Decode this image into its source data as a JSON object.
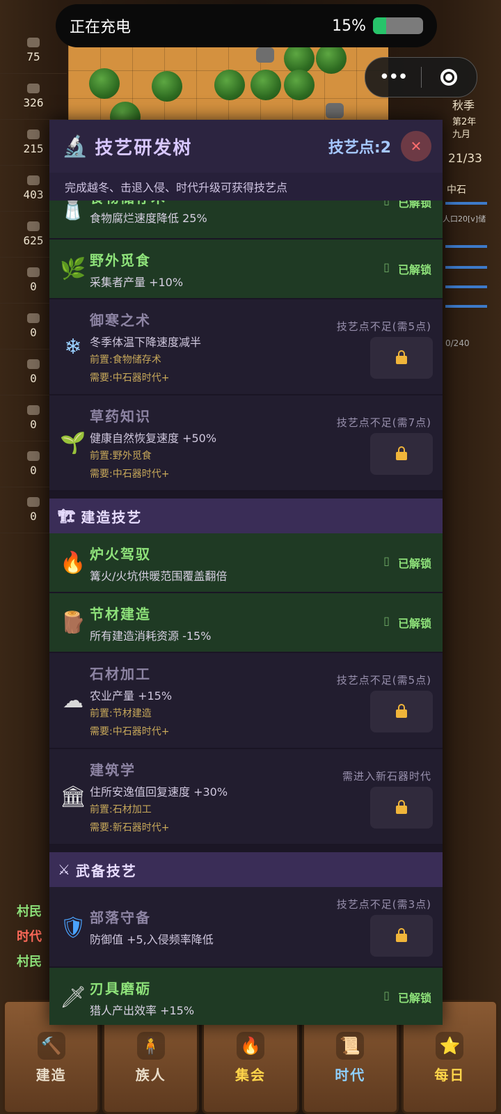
{
  "status_bar": {
    "left_text": "正在充电",
    "battery_percent": "15%",
    "battery_level": 0.15
  },
  "resources": [
    "75",
    "326",
    "215",
    "403",
    "625",
    "0",
    "0",
    "0",
    "0",
    "0",
    "0"
  ],
  "right_panel": {
    "season": "秋季",
    "year": "第2年",
    "month": "九月",
    "count": "21/33",
    "era": "中石",
    "pop": "人口20[v]储",
    "storage": "0/240"
  },
  "left_labels": [
    "村民",
    "时代",
    "村民"
  ],
  "modal": {
    "title": "技艺研发树",
    "tech_points": "技艺点:2",
    "hint": "完成越冬、击退入侵、时代升级可获得技艺点"
  },
  "techs_food": [
    {
      "name": "食物储存术",
      "desc": "食物腐烂速度降低 25%",
      "status": "已解锁",
      "icon": "salt-icon"
    },
    {
      "name": "野外觅食",
      "desc": "采集者产量 +10%",
      "status": "已解锁",
      "icon": "herb-icon"
    },
    {
      "name": "御寒之术",
      "desc": "冬季体温下降速度减半",
      "prereq": "前置:食物储存术",
      "req": "需要:中石器时代+",
      "cost": "技艺点不足(需5点)",
      "icon": "snowflake-icon"
    },
    {
      "name": "草药知识",
      "desc": "健康自然恢复速度 +50%",
      "prereq": "前置:野外觅食",
      "req": "需要:中石器时代+",
      "cost": "技艺点不足(需7点)",
      "icon": "seedling-icon"
    }
  ],
  "section_build": {
    "title": "建造技艺",
    "icon": "crane-icon"
  },
  "techs_build": [
    {
      "name": "炉火驾驭",
      "desc": "篝火/火坑供暖范围覆盖翻倍",
      "status": "已解锁",
      "icon": "fire-icon"
    },
    {
      "name": "节材建造",
      "desc": "所有建造消耗资源 -15%",
      "status": "已解锁",
      "icon": "wood-icon"
    },
    {
      "name": "石材加工",
      "desc": "农业产量 +15%",
      "prereq": "前置:节材建造",
      "req": "需要:中石器时代+",
      "cost": "技艺点不足(需5点)",
      "icon": "rock-icon"
    },
    {
      "name": "建筑学",
      "desc": "住所安逸值回复速度 +30%",
      "prereq": "前置:石材加工",
      "req": "需要:新石器时代+",
      "cost": "需进入新石器时代",
      "icon": "building-icon"
    }
  ],
  "section_arms": {
    "title": "武备技艺",
    "icon": "swords-icon"
  },
  "techs_arms": [
    {
      "name": "部落守备",
      "desc": "防御值 +5,入侵频率降低",
      "cost": "技艺点不足(需3点)",
      "icon": "shield-icon"
    },
    {
      "name": "刃具磨砺",
      "desc": "猎人产出效率 +15%",
      "status": "已解锁",
      "icon": "dagger-icon"
    }
  ],
  "bottom_nav": [
    {
      "label": "建造",
      "color": "#e8dcc8"
    },
    {
      "label": "族人",
      "color": "#e8dcc8"
    },
    {
      "label": "集会",
      "color": "#ffd54a"
    },
    {
      "label": "时代",
      "color": "#8fd0ff"
    },
    {
      "label": "每日",
      "color": "#ffd54a"
    }
  ]
}
